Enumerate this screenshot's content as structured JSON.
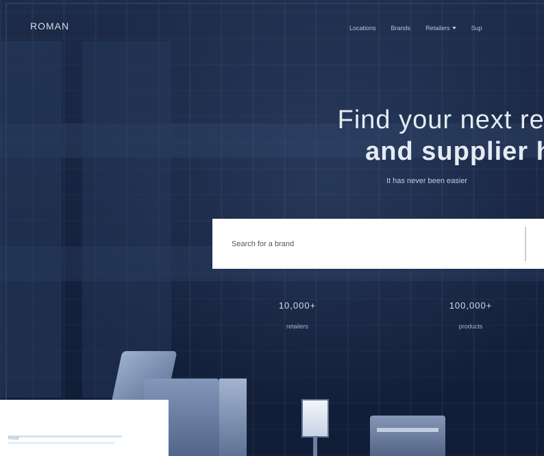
{
  "header": {
    "logo": "ROMAN",
    "nav": [
      {
        "label": "Locations",
        "dropdown": false
      },
      {
        "label": "Brands",
        "dropdown": false
      },
      {
        "label": "Retailers",
        "dropdown": true
      },
      {
        "label": "Sup",
        "dropdown": false
      }
    ]
  },
  "hero": {
    "title_line1": "Find your next retail",
    "title_line2_prefix": "and",
    "title_line2_bold": "supplier",
    "title_line2_suffix": "h",
    "subtitle": "It has never been easier"
  },
  "search": {
    "placeholder": "Search for a brand"
  },
  "stats": [
    {
      "value": "10,000+",
      "label": "retailers"
    },
    {
      "value": "100,000+",
      "label": "products"
    }
  ],
  "card": {
    "label": "Retail"
  },
  "colors": {
    "background": "#16233f",
    "search_bg": "#ffffff",
    "text_light": "#e6ebf3"
  }
}
